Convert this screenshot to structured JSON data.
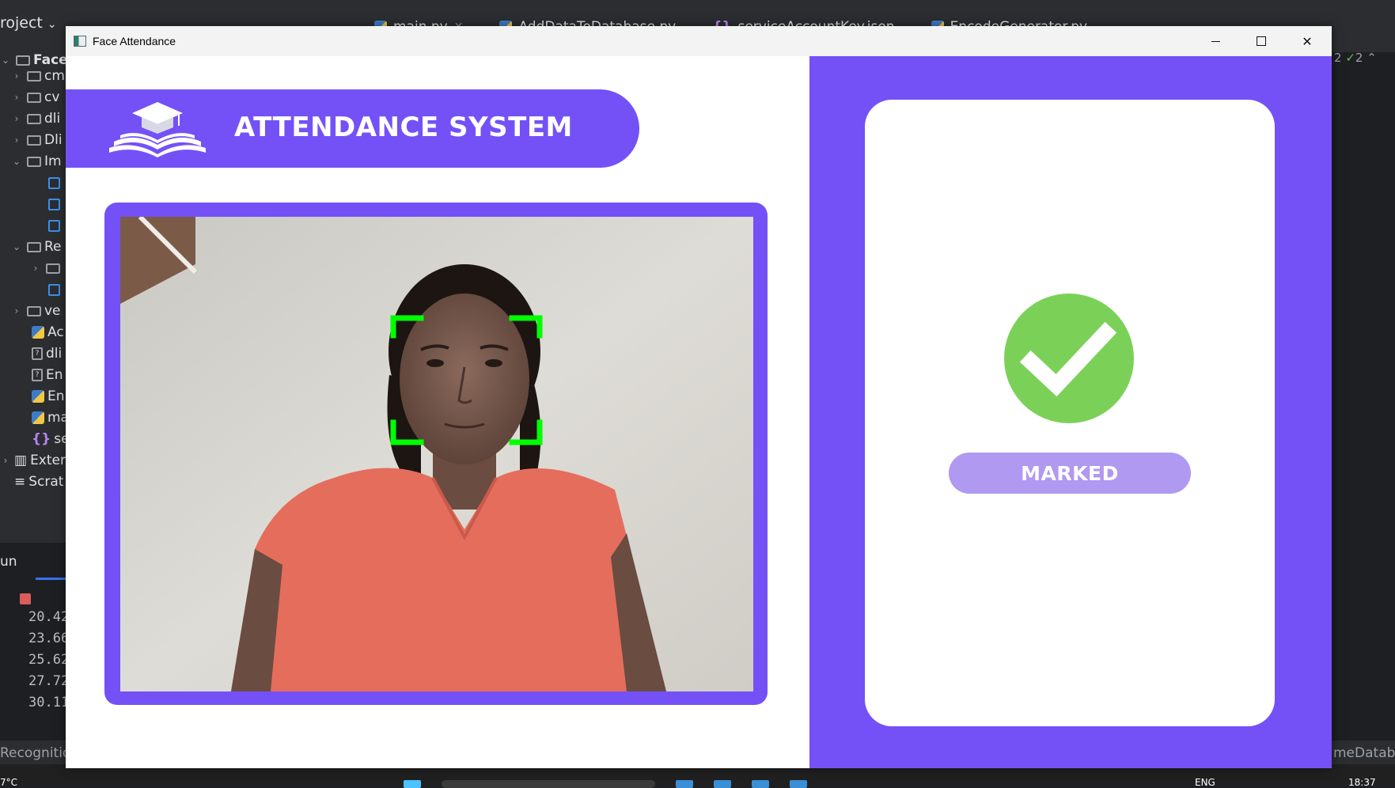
{
  "ide": {
    "project_label": "roject",
    "tabs": [
      {
        "label": "main.py",
        "icon": "python-icon"
      },
      {
        "label": "AddDataToDatabase.py",
        "icon": "python-icon"
      },
      {
        "label": "serviceAccountKey.json",
        "icon": "json-icon"
      },
      {
        "label": "EncodeGenerator.py",
        "icon": "python-icon"
      }
    ],
    "tree": [
      {
        "label": "Face",
        "type": "folder",
        "expanded": true
      },
      {
        "label": "cm",
        "type": "folder"
      },
      {
        "label": "cv",
        "type": "folder"
      },
      {
        "label": "dli",
        "type": "folder"
      },
      {
        "label": "Dli",
        "type": "folder"
      },
      {
        "label": "Im",
        "type": "folder",
        "expanded": true
      },
      {
        "label": "",
        "type": "image"
      },
      {
        "label": "",
        "type": "image"
      },
      {
        "label": "",
        "type": "image"
      },
      {
        "label": "Re",
        "type": "folder",
        "expanded": true
      },
      {
        "label": "",
        "type": "folder"
      },
      {
        "label": "",
        "type": "image"
      },
      {
        "label": "ve",
        "type": "folder"
      },
      {
        "label": "Ac",
        "type": "python"
      },
      {
        "label": "dli",
        "type": "file"
      },
      {
        "label": "En",
        "type": "file"
      },
      {
        "label": "En",
        "type": "python"
      },
      {
        "label": "ma",
        "type": "python"
      },
      {
        "label": "se",
        "type": "json"
      },
      {
        "label": "Exter",
        "type": "library"
      },
      {
        "label": "Scrat",
        "type": "scratch"
      }
    ],
    "run_label": "un",
    "console_lines": [
      "20.42",
      "23.66",
      "25.62",
      "27.72",
      "30.11"
    ],
    "gutter_text": "2",
    "gutter_check_count": "2",
    "status_left": "Recognition",
    "status_right": "meDatabas"
  },
  "taskbar": {
    "weather": "7°C",
    "lang": "ENG",
    "time": "18:37"
  },
  "window": {
    "title": "Face Attendance",
    "app_icon": "app-window-icon"
  },
  "app": {
    "system_title": "ATTENDANCE SYSTEM",
    "logo_icon": "graduation-cap-book-icon",
    "status_label": "MARKED",
    "status_icon": "check-circle-icon",
    "colors": {
      "primary": "#7451f6",
      "pill": "#af99f1",
      "check_green": "#7bd158",
      "face_box": "#00ff00"
    }
  }
}
